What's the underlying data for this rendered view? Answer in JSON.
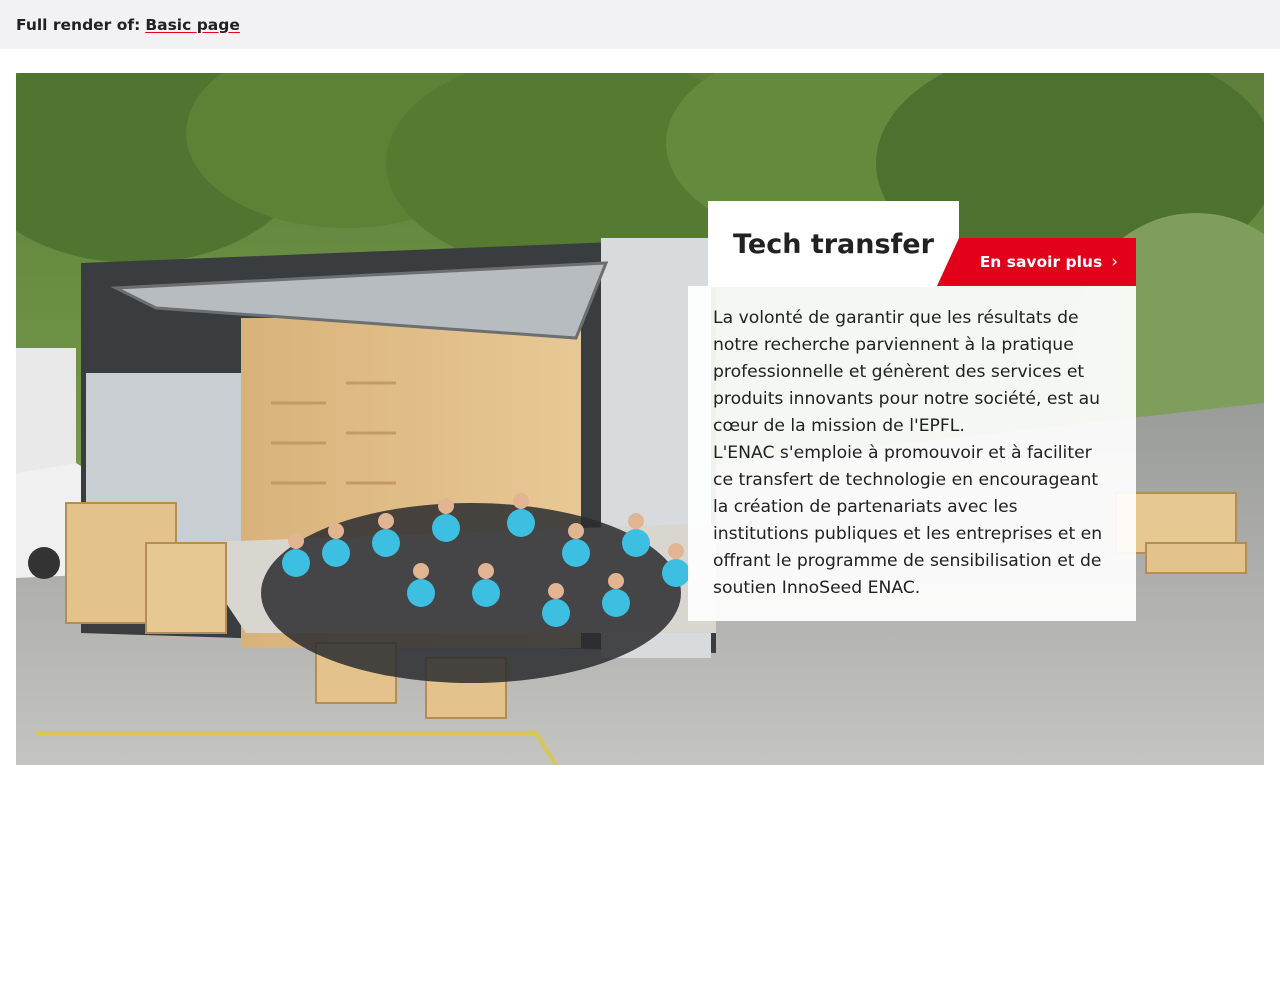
{
  "topbar": {
    "prefix": "Full render of:",
    "link_label": "Basic page"
  },
  "hero": {
    "image_alt": "Team in front of a solar decathlon house",
    "title": "Tech transfer",
    "cta_label": "En savoir plus",
    "cta_icon": "chevron-right-icon",
    "paragraphs": [
      "La volonté de garantir que les résultats de notre recherche parviennent à la pratique professionnelle et génèrent des services et produits innovants pour notre société, est au cœur de la mission de l'EPFL.",
      "L'ENAC s'emploie à promouvoir et à faciliter ce transfert de technologie en encourageant la création de partenariats avec les institutions publiques et les entreprises et en offrant le programme de sensibilisation et de soutien InnoSeed ENAC."
    ]
  },
  "colors": {
    "accent": "#e2001a",
    "topbar_bg": "#f2f2f4",
    "text": "#212121"
  }
}
